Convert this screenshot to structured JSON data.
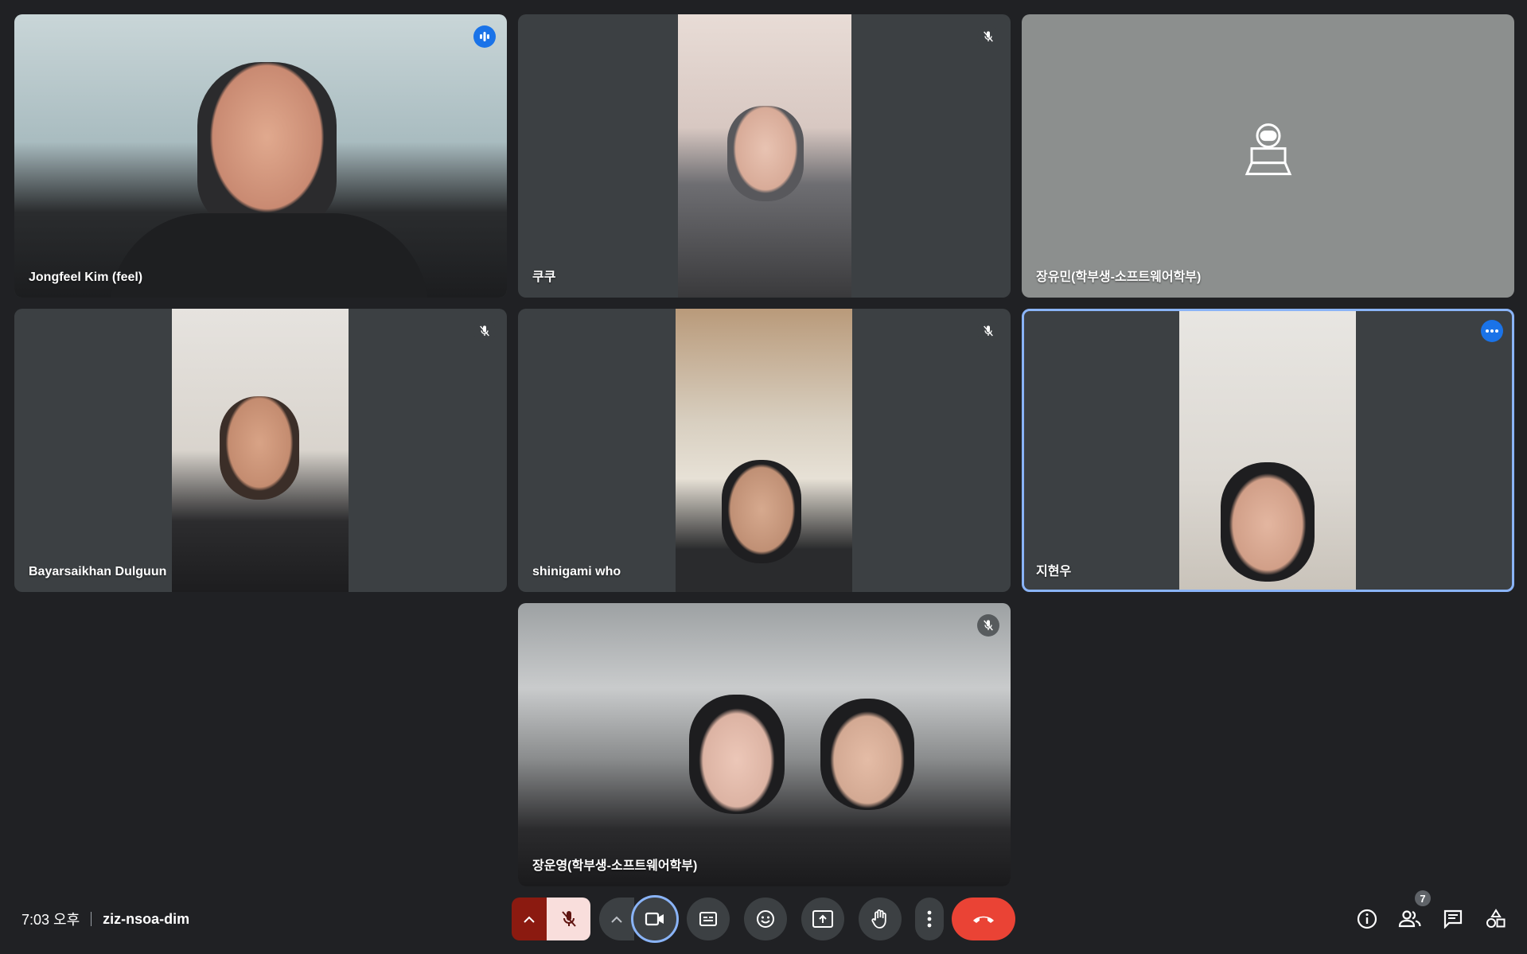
{
  "participants": [
    {
      "name": "Jongfeel Kim (feel)",
      "status": "speaking"
    },
    {
      "name": "쿠쿠",
      "status": "muted"
    },
    {
      "name": "장유민(학부생-소프트웨어학부)",
      "status": "camera-off"
    },
    {
      "name": "Bayarsaikhan Dulguun",
      "status": "muted"
    },
    {
      "name": "shinigami who",
      "status": "muted"
    },
    {
      "name": "지현우",
      "status": "pinned-options"
    },
    {
      "name": "장운영(학부생-소프트웨어학부)",
      "status": "muted"
    }
  ],
  "meeting": {
    "time": "7:03 오후",
    "code": "ziz-nsoa-dim"
  },
  "toolbar": {
    "icons": [
      "chevron-up-icon",
      "mic-off-icon",
      "videocam-icon",
      "closed-caption-icon",
      "emoji-icon",
      "present-screen-icon",
      "raise-hand-icon",
      "more-vert-icon",
      "call-end-icon"
    ]
  },
  "side": {
    "people_count": "7",
    "icons": [
      "info-icon",
      "people-icon",
      "chat-icon",
      "activities-icon"
    ]
  },
  "colors": {
    "background": "#202124",
    "tile": "#3c4043",
    "accent": "#1a73e8",
    "end_call": "#ea4335",
    "mic_off_bg": "#f9dedc"
  }
}
